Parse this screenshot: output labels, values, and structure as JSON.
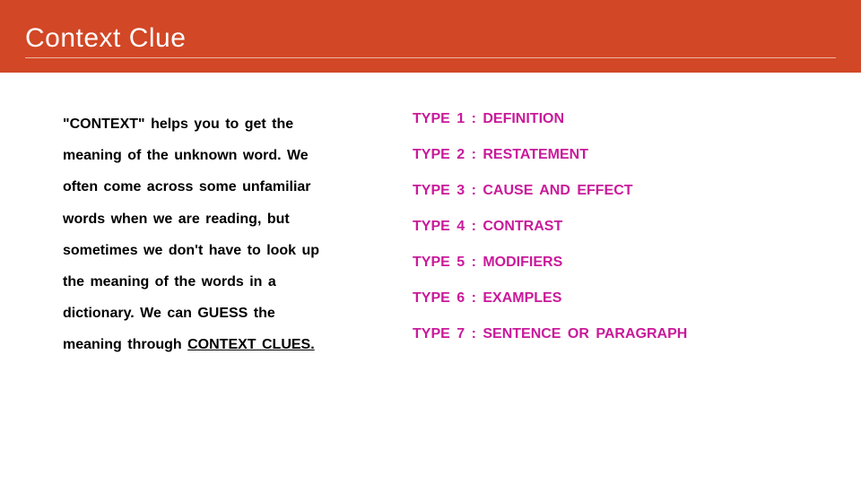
{
  "title": "Context Clue",
  "paragraph": {
    "prefix": "\"CONTEXT\" helps you to get the meaning of the unknown word. We often come across some unfamiliar words when we are reading, but sometimes we don't have to look up the meaning of the words in a dictionary. We can GUESS the meaning through ",
    "underlined": "CONTEXT CLUES."
  },
  "types": [
    "TYPE 1 : DEFINITION",
    "TYPE 2 : RESTATEMENT",
    "TYPE 3 : CAUSE AND EFFECT",
    "TYPE 4 : CONTRAST",
    "TYPE 5 : MODIFIERS",
    "TYPE 6 : EXAMPLES",
    "TYPE 7 : SENTENCE OR PARAGRAPH"
  ]
}
